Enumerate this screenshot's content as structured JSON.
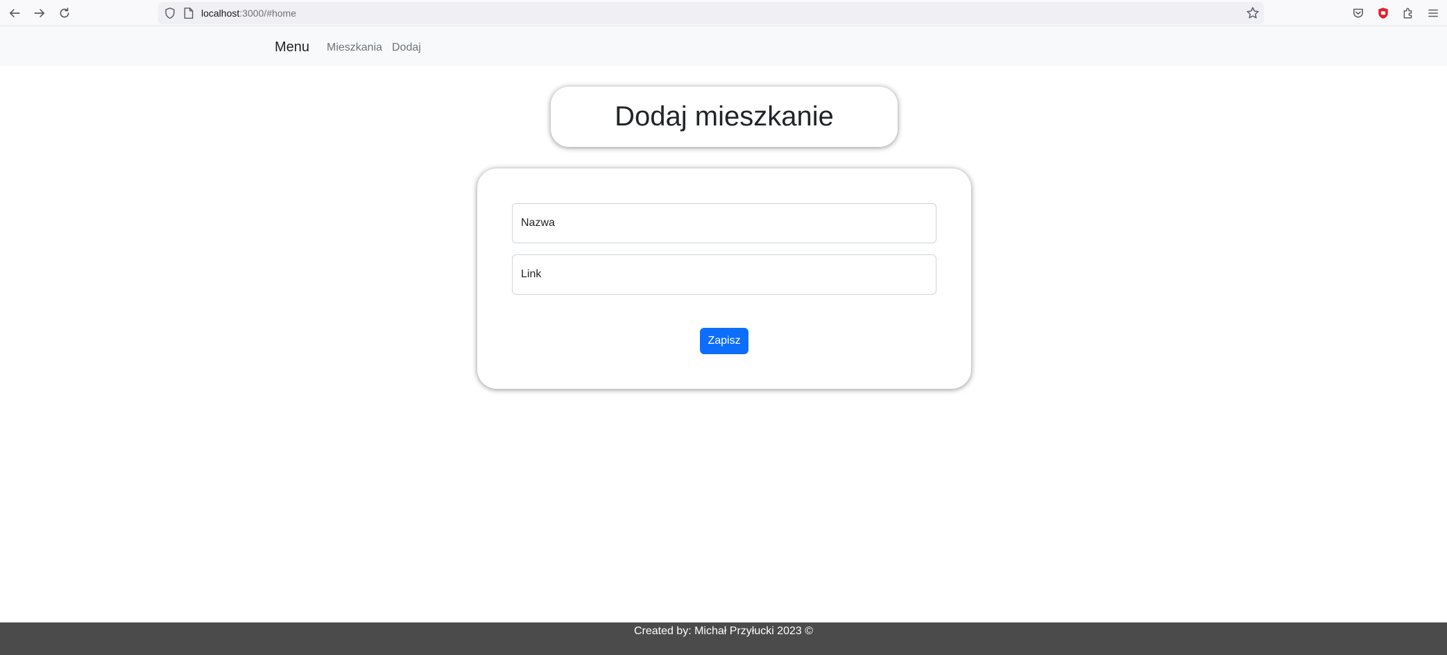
{
  "browser": {
    "url_host": "localhost",
    "url_rest": ":3000/#home"
  },
  "navbar": {
    "brand": "Menu",
    "links": [
      {
        "label": "Mieszkania"
      },
      {
        "label": "Dodaj"
      }
    ]
  },
  "page": {
    "title": "Dodaj mieszkanie"
  },
  "form": {
    "name_placeholder": "Nazwa",
    "link_placeholder": "Link",
    "submit_label": "Zapisz"
  },
  "footer": {
    "text": "Created by: Michał Przyłucki 2023 ©"
  },
  "colors": {
    "primary": "#0d6efd",
    "navbar_bg": "#f8f9fa",
    "footer_bg": "#4b4b4b",
    "ublock_red": "#e0202e"
  },
  "icons": [
    "back-icon",
    "forward-icon",
    "reload-icon",
    "shield-icon",
    "page-icon",
    "star-icon",
    "pocket-icon",
    "ublock-icon",
    "extensions-icon",
    "menu-icon"
  ]
}
